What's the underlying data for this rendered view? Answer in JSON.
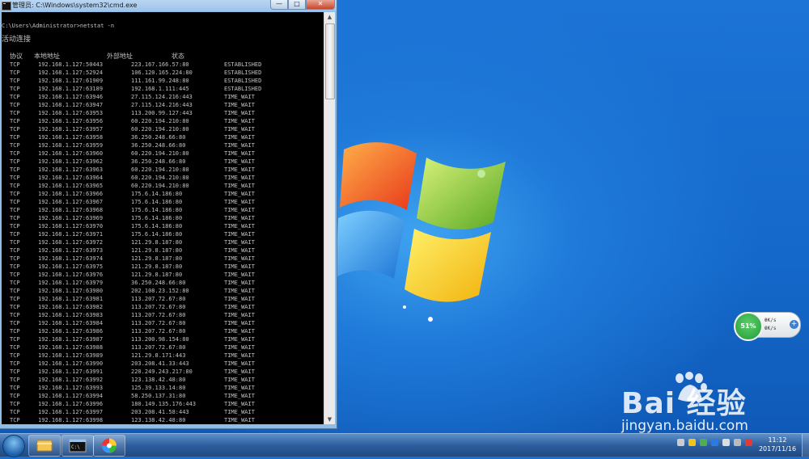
{
  "window": {
    "title": "管理员: C:\\Windows\\system32\\cmd.exe",
    "buttons": {
      "minimize": "—",
      "maximize": "□",
      "close": "✕"
    }
  },
  "console": {
    "prompt": "C:\\Users\\Administrator>netstat -n",
    "section_title": "活动连接",
    "headers": {
      "proto": "协议",
      "local": "本地地址",
      "foreign": "外部地址",
      "state": "状态"
    },
    "connections": [
      [
        "TCP",
        "192.168.1.127:50443",
        "223.167.166.57:80",
        "ESTABLISHED"
      ],
      [
        "TCP",
        "192.168.1.127:52924",
        "106.120.165.224:80",
        "ESTABLISHED"
      ],
      [
        "TCP",
        "192.168.1.127:61909",
        "111.161.99.248:80",
        "ESTABLISHED"
      ],
      [
        "TCP",
        "192.168.1.127:63189",
        "192.168.1.111:445",
        "ESTABLISHED"
      ],
      [
        "TCP",
        "192.168.1.127:63946",
        "27.115.124.216:443",
        "TIME_WAIT"
      ],
      [
        "TCP",
        "192.168.1.127:63947",
        "27.115.124.216:443",
        "TIME_WAIT"
      ],
      [
        "TCP",
        "192.168.1.127:63953",
        "113.200.99.127:443",
        "TIME_WAIT"
      ],
      [
        "TCP",
        "192.168.1.127:63956",
        "60.220.194.210:80",
        "TIME_WAIT"
      ],
      [
        "TCP",
        "192.168.1.127:63957",
        "60.220.194.210:80",
        "TIME_WAIT"
      ],
      [
        "TCP",
        "192.168.1.127:63958",
        "36.250.248.66:80",
        "TIME_WAIT"
      ],
      [
        "TCP",
        "192.168.1.127:63959",
        "36.250.248.66:80",
        "TIME_WAIT"
      ],
      [
        "TCP",
        "192.168.1.127:63960",
        "60.220.194.210:80",
        "TIME_WAIT"
      ],
      [
        "TCP",
        "192.168.1.127:63962",
        "36.250.248.66:80",
        "TIME_WAIT"
      ],
      [
        "TCP",
        "192.168.1.127:63963",
        "60.220.194.210:80",
        "TIME_WAIT"
      ],
      [
        "TCP",
        "192.168.1.127:63964",
        "60.220.194.210:80",
        "TIME_WAIT"
      ],
      [
        "TCP",
        "192.168.1.127:63965",
        "60.220.194.210:80",
        "TIME_WAIT"
      ],
      [
        "TCP",
        "192.168.1.127:63966",
        "175.6.14.186:80",
        "TIME_WAIT"
      ],
      [
        "TCP",
        "192.168.1.127:63967",
        "175.6.14.186:80",
        "TIME_WAIT"
      ],
      [
        "TCP",
        "192.168.1.127:63968",
        "175.6.14.186:80",
        "TIME_WAIT"
      ],
      [
        "TCP",
        "192.168.1.127:63969",
        "175.6.14.186:80",
        "TIME_WAIT"
      ],
      [
        "TCP",
        "192.168.1.127:63970",
        "175.6.14.186:80",
        "TIME_WAIT"
      ],
      [
        "TCP",
        "192.168.1.127:63971",
        "175.6.14.186:80",
        "TIME_WAIT"
      ],
      [
        "TCP",
        "192.168.1.127:63972",
        "121.29.8.187:80",
        "TIME_WAIT"
      ],
      [
        "TCP",
        "192.168.1.127:63973",
        "121.29.8.187:80",
        "TIME_WAIT"
      ],
      [
        "TCP",
        "192.168.1.127:63974",
        "121.29.8.187:80",
        "TIME_WAIT"
      ],
      [
        "TCP",
        "192.168.1.127:63975",
        "121.29.8.187:80",
        "TIME_WAIT"
      ],
      [
        "TCP",
        "192.168.1.127:63976",
        "121.29.8.187:80",
        "TIME_WAIT"
      ],
      [
        "TCP",
        "192.168.1.127:63979",
        "36.250.248.66:80",
        "TIME_WAIT"
      ],
      [
        "TCP",
        "192.168.1.127:63980",
        "202.108.23.152:80",
        "TIME_WAIT"
      ],
      [
        "TCP",
        "192.168.1.127:63981",
        "113.207.72.67:80",
        "TIME_WAIT"
      ],
      [
        "TCP",
        "192.168.1.127:63982",
        "113.207.72.67:80",
        "TIME_WAIT"
      ],
      [
        "TCP",
        "192.168.1.127:63983",
        "113.207.72.67:80",
        "TIME_WAIT"
      ],
      [
        "TCP",
        "192.168.1.127:63984",
        "113.207.72.67:80",
        "TIME_WAIT"
      ],
      [
        "TCP",
        "192.168.1.127:63986",
        "113.207.72.67:80",
        "TIME_WAIT"
      ],
      [
        "TCP",
        "192.168.1.127:63987",
        "113.200.98.154:80",
        "TIME_WAIT"
      ],
      [
        "TCP",
        "192.168.1.127:63988",
        "113.207.72.67:80",
        "TIME_WAIT"
      ],
      [
        "TCP",
        "192.168.1.127:63989",
        "121.29.8.171:443",
        "TIME_WAIT"
      ],
      [
        "TCP",
        "192.168.1.127:63990",
        "203.208.41.33:443",
        "TIME_WAIT"
      ],
      [
        "TCP",
        "192.168.1.127:63991",
        "220.249.243.217:80",
        "TIME_WAIT"
      ],
      [
        "TCP",
        "192.168.1.127:63992",
        "123.138.42.48:80",
        "TIME_WAIT"
      ],
      [
        "TCP",
        "192.168.1.127:63993",
        "125.39.133.14:80",
        "TIME_WAIT"
      ],
      [
        "TCP",
        "192.168.1.127:63994",
        "58.250.137.31:80",
        "TIME_WAIT"
      ],
      [
        "TCP",
        "192.168.1.127:63996",
        "180.149.135.176:443",
        "TIME_WAIT"
      ],
      [
        "TCP",
        "192.168.1.127:63997",
        "203.208.41.58:443",
        "TIME_WAIT"
      ],
      [
        "TCP",
        "192.168.1.127:63998",
        "123.138.42.48:80",
        "TIME_WAIT"
      ]
    ]
  },
  "net_widget": {
    "percent": "51%",
    "upload": "0K/s",
    "download": "0K/s"
  },
  "watermark": {
    "brand": "Bai  经验",
    "url": "jingyan.baidu.com"
  },
  "clock": {
    "time": "11:12",
    "date": "2017/11/16"
  },
  "colors": {
    "desktop": "#1b6fd0",
    "console_bg": "#000000",
    "console_text": "#c0c0c0"
  },
  "taskbar_items": [
    "start-orb-icon",
    "explorer-icon",
    "cmd-icon",
    "color-app-icon"
  ]
}
